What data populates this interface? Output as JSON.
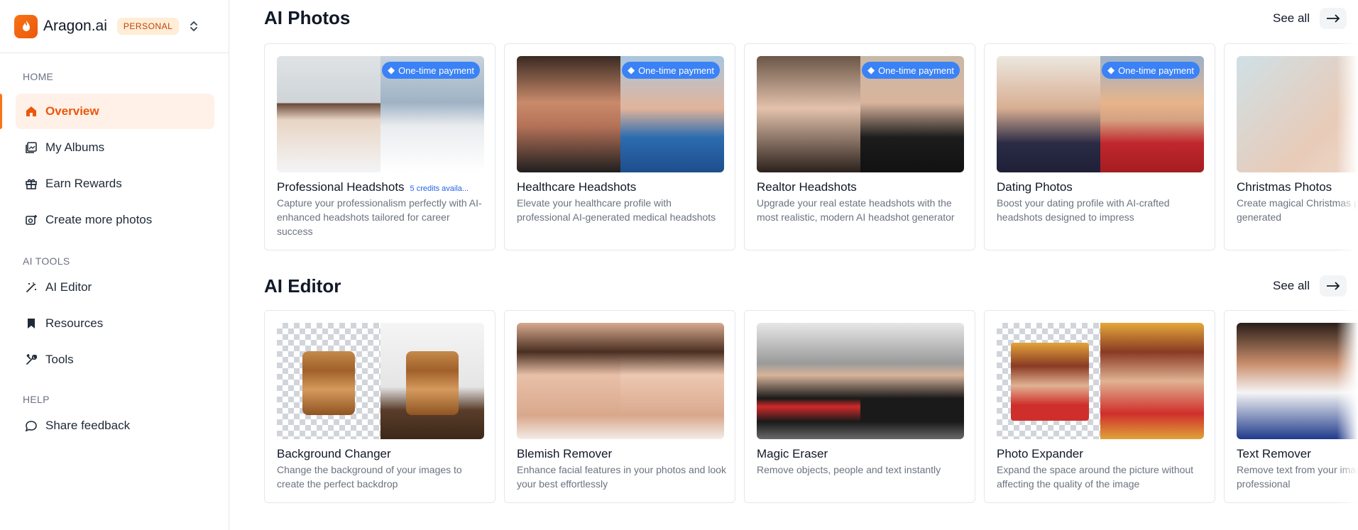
{
  "brand": {
    "name": "Aragon.ai",
    "badge": "PERSONAL"
  },
  "sidebar": {
    "sections": [
      {
        "label": "HOME"
      },
      {
        "label": "AI TOOLS"
      },
      {
        "label": "HELP"
      }
    ],
    "items": [
      {
        "label": "Overview",
        "icon": "home-icon",
        "active": true
      },
      {
        "label": "My Albums",
        "icon": "album-icon"
      },
      {
        "label": "Earn Rewards",
        "icon": "gift-icon"
      },
      {
        "label": "Create more photos",
        "icon": "camera-plus-icon"
      },
      {
        "label": "AI Editor",
        "icon": "magic-wand-icon"
      },
      {
        "label": "Resources",
        "icon": "bookmark-icon"
      },
      {
        "label": "Tools",
        "icon": "tools-icon"
      },
      {
        "label": "Share feedback",
        "icon": "message-icon"
      }
    ]
  },
  "accent": "#f97316",
  "pill_color": "#3b82f6",
  "photos": {
    "title": "AI Photos",
    "see_all": "See all",
    "pill_label": "One-time payment",
    "cards": [
      {
        "title": "Professional Headshots",
        "credits": "5 credits availa...",
        "desc": "Capture your professionalism perfectly with AI-enhanced headshots tailored for career success"
      },
      {
        "title": "Healthcare Headshots",
        "desc": "Elevate your healthcare profile with professional AI-generated medical headshots"
      },
      {
        "title": "Realtor Headshots",
        "desc": "Upgrade your real estate headshots with the most realistic, modern AI headshot generator"
      },
      {
        "title": "Dating Photos",
        "desc": "Boost your dating profile with AI-crafted headshots designed to impress"
      },
      {
        "title": "Christmas Photos",
        "desc": "Create magical Christmas photos beautifully AI-generated"
      }
    ]
  },
  "editor": {
    "title": "AI Editor",
    "see_all": "See all",
    "cards": [
      {
        "title": "Background Changer",
        "desc": "Change the background of your images to create the perfect backdrop"
      },
      {
        "title": "Blemish Remover",
        "desc": "Enhance facial features in your photos and look your best effortlessly"
      },
      {
        "title": "Magic Eraser",
        "desc": "Remove objects, people and text instantly"
      },
      {
        "title": "Photo Expander",
        "desc": "Expand the space around the picture without affecting the quality of the image"
      },
      {
        "title": "Text Remover",
        "desc": "Remove text from your images to look more professional"
      }
    ]
  }
}
